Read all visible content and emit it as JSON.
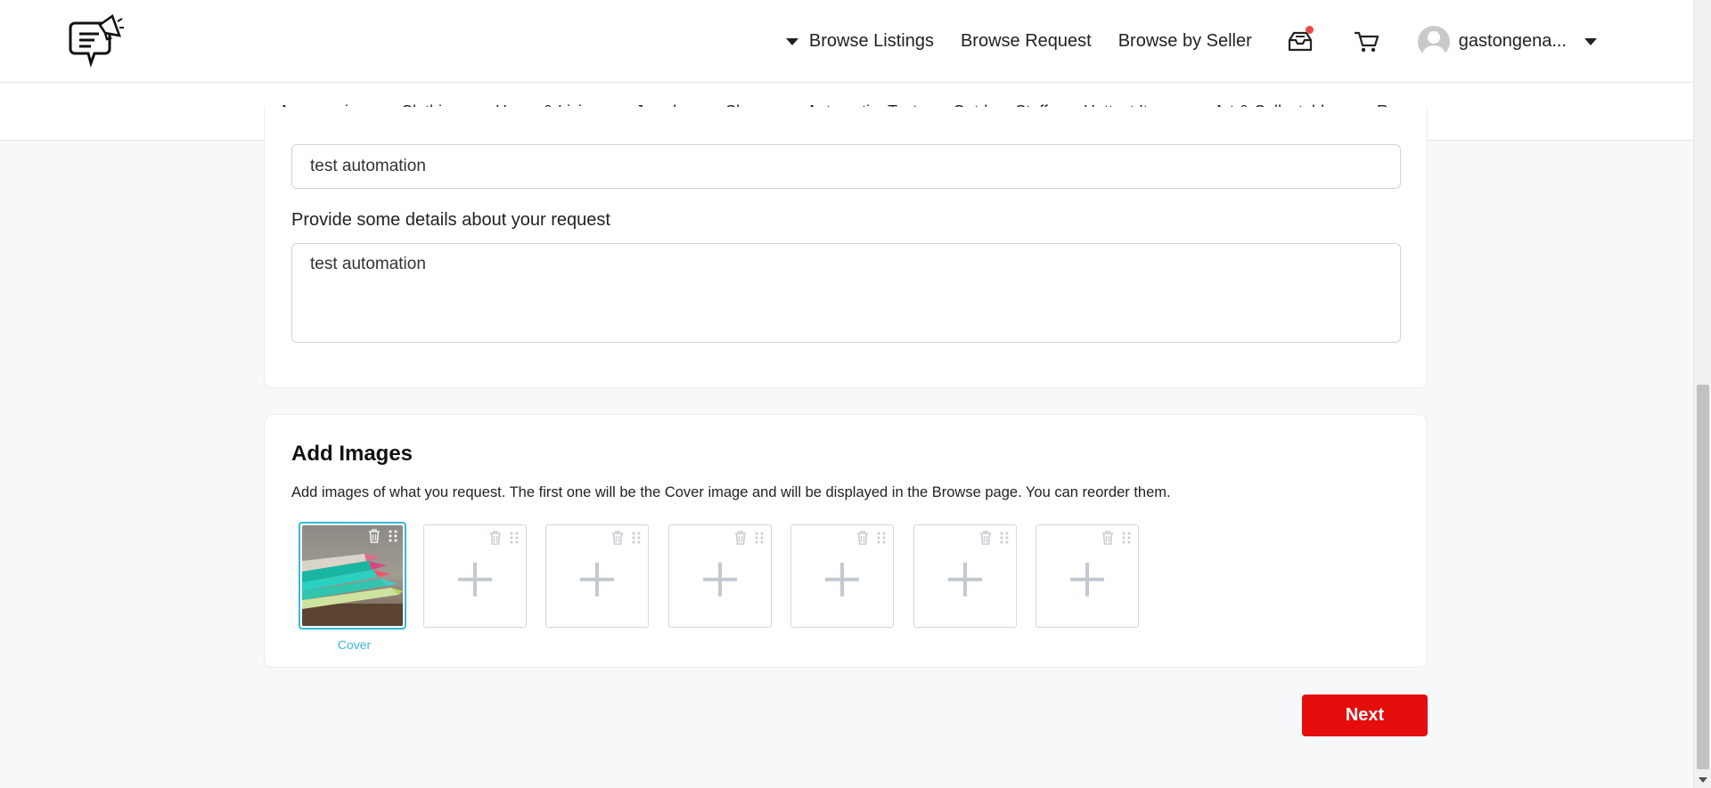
{
  "header": {
    "nav": [
      {
        "label": "Browse Listings",
        "dropdown": true
      },
      {
        "label": "Browse Request"
      },
      {
        "label": "Browse by Seller"
      }
    ],
    "icons": [
      "inbox-icon",
      "cart-icon"
    ],
    "user": {
      "name": "gastongena..."
    }
  },
  "categories": [
    "Accessories",
    "Clothing",
    "Home & Living",
    "Jewelry",
    "Shoes",
    "AutomationTest",
    "Outdoor Stuff",
    "Hottest Items",
    "Art & Collectables",
    "Rugs"
  ],
  "details": {
    "title_value": "test automation",
    "details_label": "Provide some details about your request",
    "details_value": "test automation"
  },
  "images": {
    "title": "Add Images",
    "description": "Add images of what you request. The first one will be the Cover image and will be displayed in the Browse page. You can reorder them.",
    "cover_label": "Cover",
    "empty_slots": 6
  },
  "actions": {
    "next_label": "Next"
  },
  "colors": {
    "accent": "#39b8d8",
    "primary_button": "#e60d0d",
    "notification": "#e94b4b"
  }
}
